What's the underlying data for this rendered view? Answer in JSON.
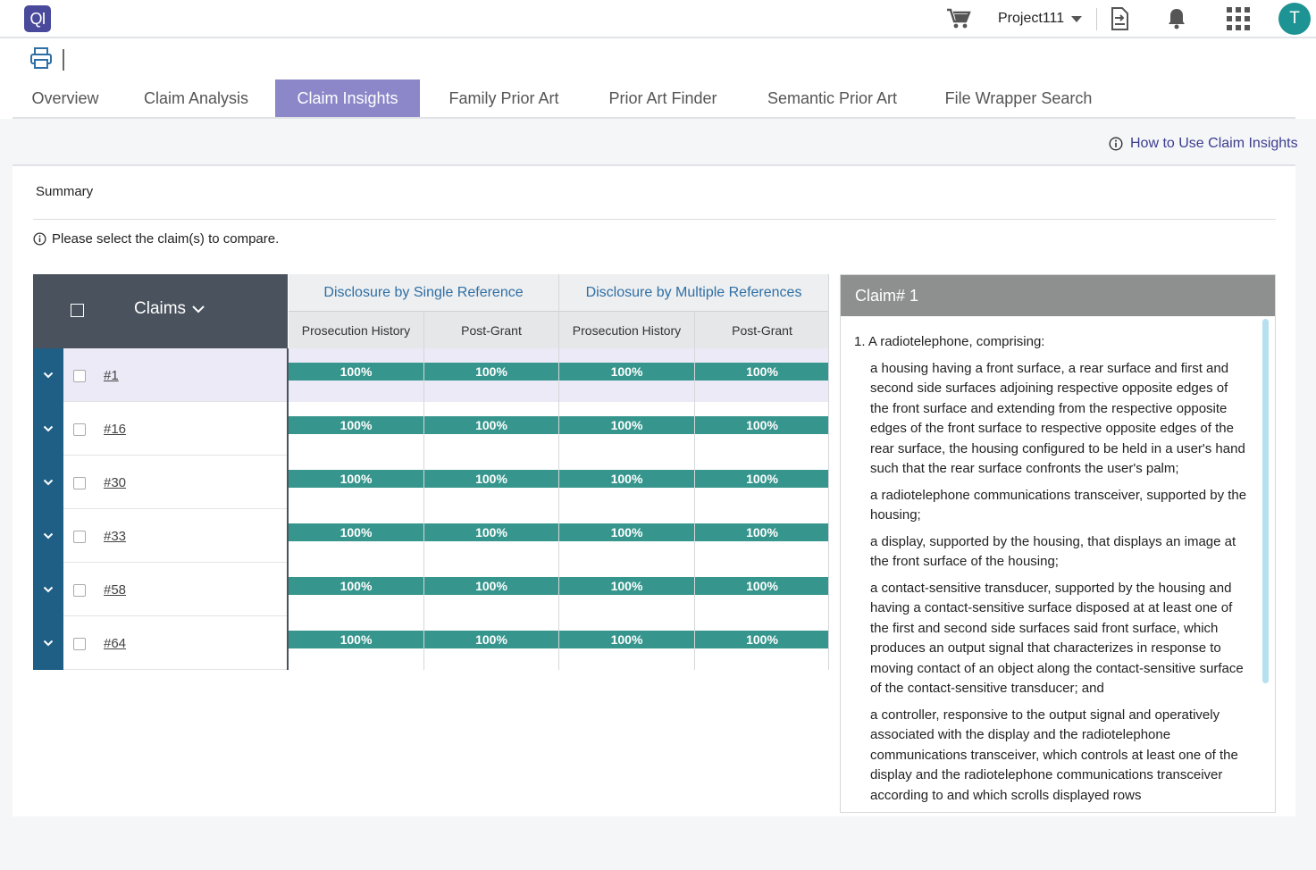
{
  "app": {
    "logo_text": "QI"
  },
  "topbar": {
    "project": "Project111",
    "avatar_initial": "T"
  },
  "tabs": [
    {
      "label": "Overview",
      "active": false
    },
    {
      "label": "Claim Analysis",
      "active": false
    },
    {
      "label": "Claim Insights",
      "active": true
    },
    {
      "label": "Family Prior Art",
      "active": false
    },
    {
      "label": "Prior Art Finder",
      "active": false
    },
    {
      "label": "Semantic Prior Art",
      "active": false
    },
    {
      "label": "File Wrapper Search",
      "active": false
    }
  ],
  "help_link": "How to Use Claim Insights",
  "summary": {
    "title": "Summary",
    "hint": "Please select the claim(s) to compare."
  },
  "table": {
    "claims_header": "Claims",
    "group_headers": [
      "Disclosure by Single Reference",
      "Disclosure by Multiple References"
    ],
    "sub_headers": [
      "Prosecution History",
      "Post-Grant",
      "Prosecution History",
      "Post-Grant"
    ],
    "rows": [
      {
        "claim": "#1",
        "values": [
          "100%",
          "100%",
          "100%",
          "100%"
        ]
      },
      {
        "claim": "#16",
        "values": [
          "100%",
          "100%",
          "100%",
          "100%"
        ]
      },
      {
        "claim": "#30",
        "values": [
          "100%",
          "100%",
          "100%",
          "100%"
        ]
      },
      {
        "claim": "#33",
        "values": [
          "100%",
          "100%",
          "100%",
          "100%"
        ]
      },
      {
        "claim": "#58",
        "values": [
          "100%",
          "100%",
          "100%",
          "100%"
        ]
      },
      {
        "claim": "#64",
        "values": [
          "100%",
          "100%",
          "100%",
          "100%"
        ]
      }
    ]
  },
  "claim_panel": {
    "title": "Claim# 1",
    "lead": "1. A radiotelephone, comprising:",
    "paragraphs": [
      "a housing having a front surface, a rear surface and first and second side surfaces adjoining respective opposite edges of the front surface and extending from the respective opposite edges of the front surface to respective opposite edges of the rear surface, the housing configured to be held in a user's hand such that the rear surface confronts the user's palm;",
      "a radiotelephone communications transceiver, supported by the housing;",
      "a display, supported by the housing, that displays an image at the front surface of the housing;",
      "a contact-sensitive transducer, supported by the housing and having a contact-sensitive surface disposed at at least one of the first and second side surfaces said front surface, which produces an output signal that characterizes in response to moving contact of an object along the contact-sensitive surface of the contact-sensitive transducer; and",
      "a controller, responsive to the output signal and operatively associated with the display and the radiotelephone communications transceiver, which controls at least one of the display and the radiotelephone communications transceiver according to and which scrolls displayed rows"
    ]
  },
  "colors": {
    "brand": "#4a4a9c",
    "active_tab": "#8b87c9",
    "bar": "#36968d",
    "expander": "#1f5f86",
    "header_dark": "#4a535d",
    "avatar": "#1e9393"
  }
}
